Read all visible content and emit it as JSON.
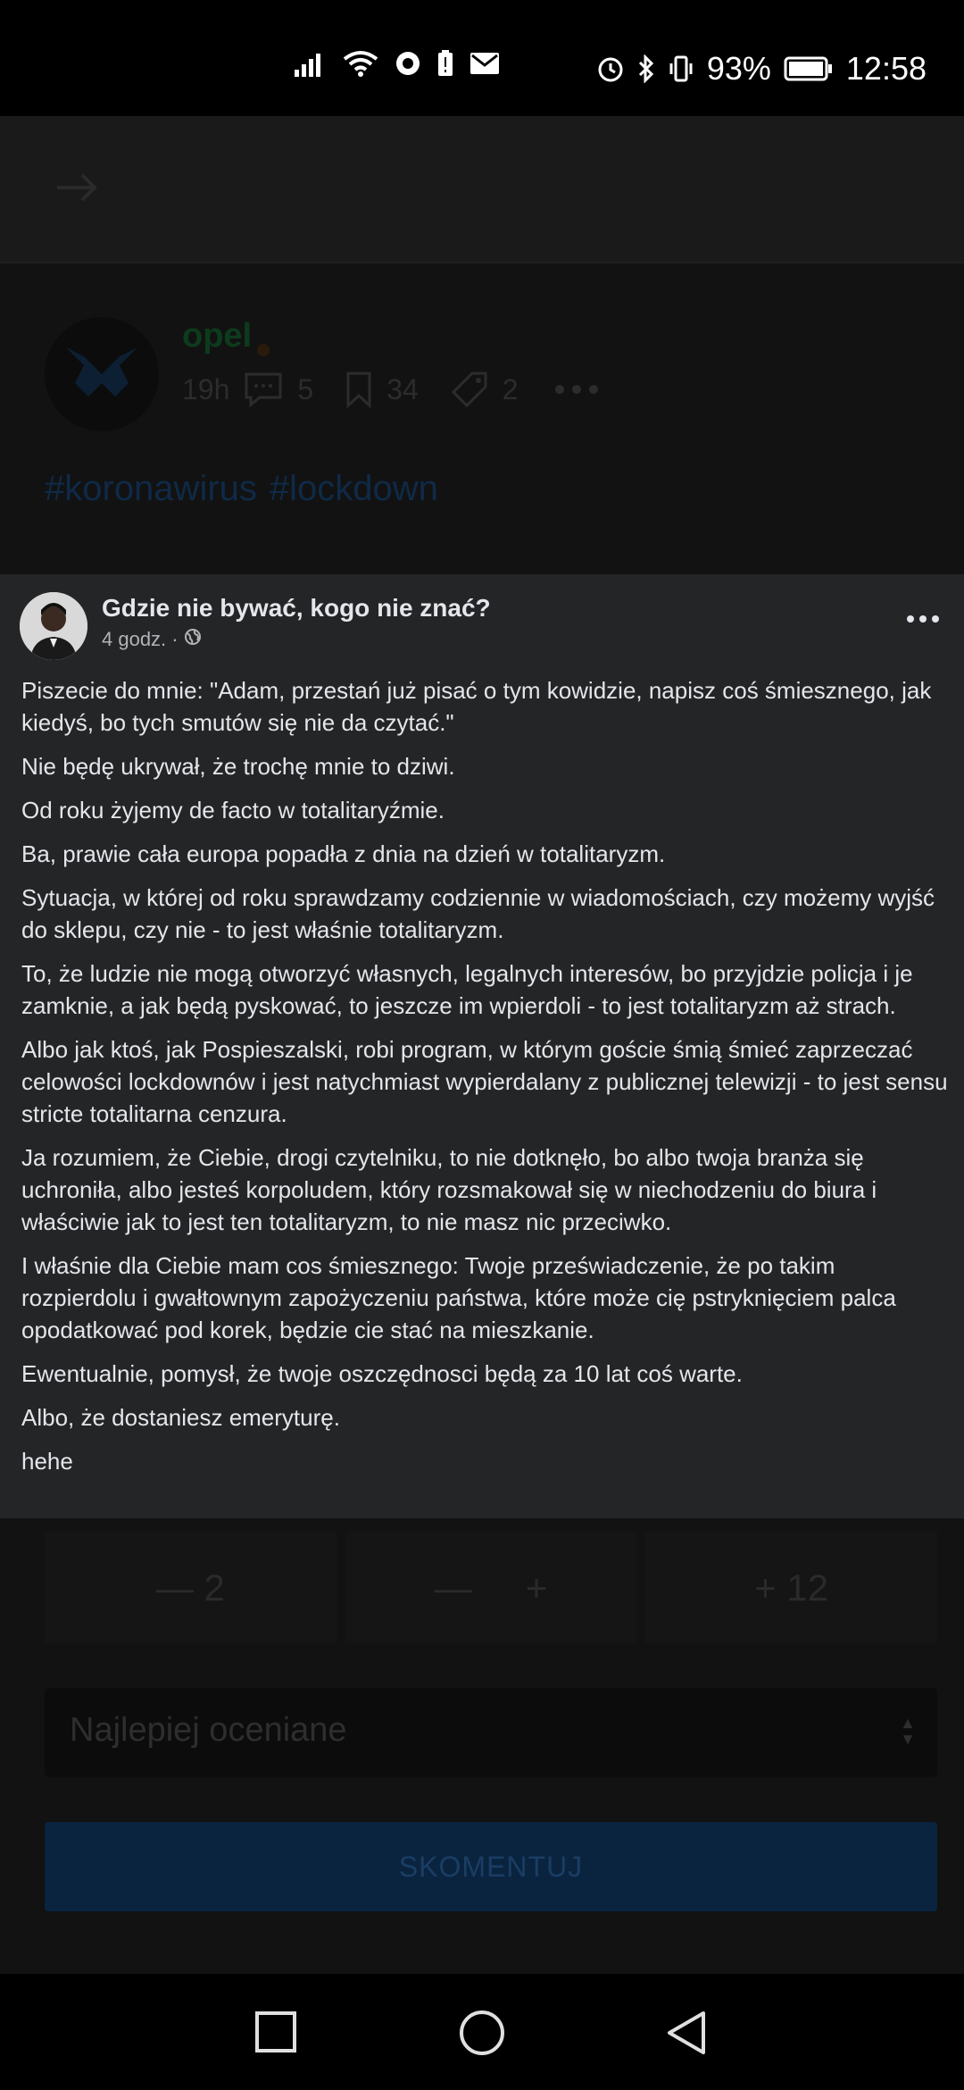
{
  "statusbar": {
    "battery_percent": "93%",
    "time": "12:58"
  },
  "post": {
    "author": "opel",
    "age": "19h",
    "comments_count": "5",
    "bookmarks_count": "34",
    "tags_count": "2",
    "tags": [
      "#koronawirus",
      "#lockdown"
    ]
  },
  "fb_card": {
    "name": "Gdzie nie bywać, kogo nie znać?",
    "time": "4 godz. ·",
    "paragraphs": [
      "Piszecie do mnie: \"Adam, przestań już pisać o tym kowidzie, napisz coś śmiesznego, jak kiedyś, bo tych smutów się nie da czytać.\"",
      "Nie będę ukrywał, że trochę mnie to dziwi.",
      "Od roku żyjemy de facto w totalitaryźmie.",
      "Ba, prawie cała europa popadła z dnia na dzień w totalitaryzm.",
      "Sytuacja, w której od roku sprawdzamy codziennie w wiadomościach, czy możemy wyjść do sklepu, czy nie - to jest właśnie totalitaryzm.",
      "To, że ludzie nie mogą otworzyć własnych, legalnych interesów, bo przyjdzie policja i je zamknie, a jak będą pyskować, to jeszcze im wpierdoli - to jest totalitaryzm aż strach.",
      "Albo jak ktoś, jak Pospieszalski, robi program, w którym goście śmią śmieć zaprzeczać celowości lockdownów i jest natychmiast wypierdalany z publicznej telewizji - to jest sensu stricte totalitarna cenzura.",
      "Ja rozumiem, że Ciebie, drogi czytelniku, to nie dotknęło, bo albo twoja branża się uchroniła, albo jesteś korpoludem, który rozsmakował się w niechodzeniu do biura i właściwie jak to jest ten totalitaryzm, to nie masz nic przeciwko.",
      "I właśnie dla Ciebie mam cos śmiesznego: Twoje przeświadczenie, że po takim rozpierdolu i gwałtownym zapożyczeniu państwa,  które może cię pstryknięciem palca opodatkować pod korek, będzie cie stać na mieszkanie.",
      "Ewentualnie, pomysł, że twoje oszczędnosci będą za 10 lat coś warte.",
      "Albo, że dostaniesz emeryturę.",
      "hehe"
    ]
  },
  "votes": {
    "minus_label": "— 2",
    "minus_sign": "—",
    "plus_sign": "+",
    "plus_label": "+ 12"
  },
  "sort": {
    "selected": "Najlepiej oceniane"
  },
  "comment_button": "SKOMENTUJ",
  "colors": {
    "card_bg": "#242526",
    "app_bg": "#121212",
    "accent_blue_dim": "#0a2440"
  }
}
